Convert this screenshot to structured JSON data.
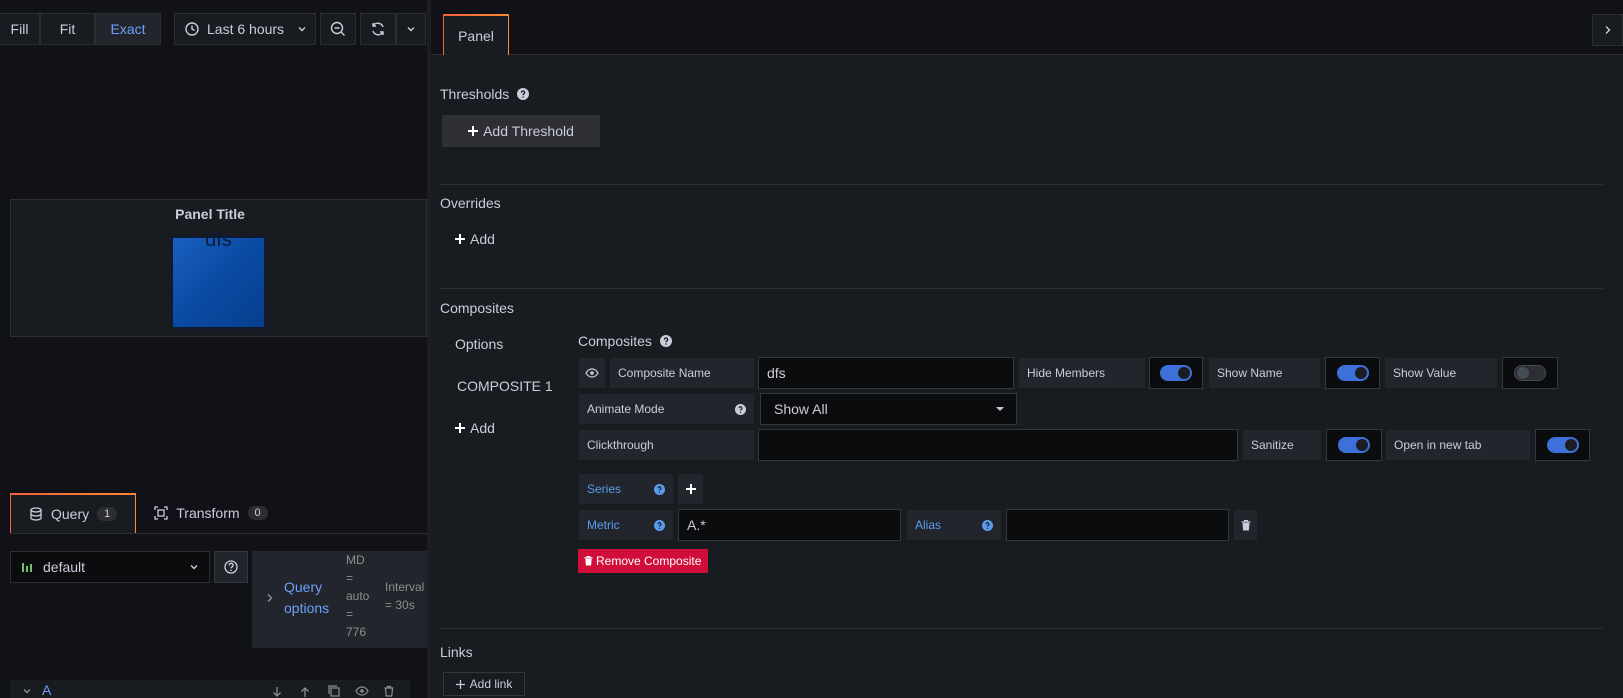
{
  "toolbar": {
    "fill": "Fill",
    "fit": "Fit",
    "exact": "Exact",
    "time_range": "Last 6 hours"
  },
  "preview": {
    "panel_title": "Panel Title",
    "stat_value": "dfs"
  },
  "query_tabs": {
    "query_label": "Query",
    "query_count": "1",
    "transform_label": "Transform",
    "transform_count": "0"
  },
  "query": {
    "datasource": "default",
    "options_title_1": "Query",
    "options_title_2": "options",
    "md_1": "MD",
    "md_2": "=",
    "md_3": "auto",
    "md_4": "=",
    "md_5": "776",
    "interval_1": "Interval",
    "interval_2": "= 30s",
    "row_label": "A"
  },
  "editor": {
    "tab_panel": "Panel",
    "thresholds_title": "Thresholds",
    "add_threshold": "Add Threshold",
    "overrides_title": "Overrides",
    "overrides_add": "Add",
    "composites_title": "Composites",
    "nav_options": "Options",
    "nav_composite_1": "COMPOSITE 1",
    "nav_add": "Add",
    "composites_sub": "Composites",
    "composite_name_label": "Composite Name",
    "composite_name_value": "dfs",
    "hide_members": "Hide Members",
    "show_name": "Show Name",
    "show_value": "Show Value",
    "animate_mode": "Animate Mode",
    "animate_value": "Show All",
    "clickthrough": "Clickthrough",
    "clickthrough_value": "",
    "sanitize": "Sanitize",
    "open_new_tab": "Open in new tab",
    "series": "Series",
    "metric": "Metric",
    "metric_value": "A.*",
    "alias": "Alias",
    "alias_value": "",
    "remove_composite": "Remove Composite",
    "links_title": "Links",
    "add_link": "Add link"
  },
  "toggles": {
    "hide_members": true,
    "show_name": true,
    "show_value": false,
    "sanitize": true,
    "open_new_tab": true
  },
  "colors": {
    "accent_blue": "#3d71d9",
    "link_blue": "#6e9fff",
    "danger_red": "#d10e3a",
    "active_tab_gradient": "#f55f3e"
  }
}
